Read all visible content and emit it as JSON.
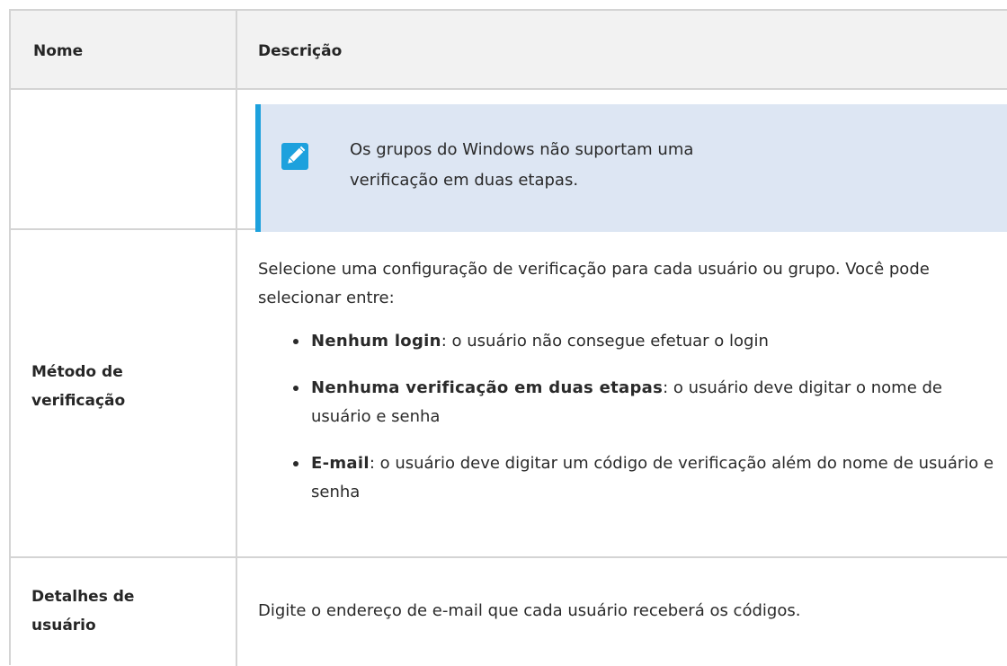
{
  "table": {
    "headers": {
      "name": "Nome",
      "description": "Descrição"
    },
    "note_row": {
      "icon": "pencil-note-icon",
      "note_text": "Os grupos do Windows não suportam uma verificação em duas etapas."
    },
    "method_row": {
      "name": "Método de verificação",
      "intro": "Selecione uma configuração de verificação para cada usuário ou grupo. Você pode selecionar entre:",
      "options": [
        {
          "term": "Nenhum login",
          "text": ": o usuário não consegue efetuar o login"
        },
        {
          "term": "Nenhuma verificação em duas etapas",
          "text": ": o usuário deve digitar o nome de usuário e senha"
        },
        {
          "term": "E-mail",
          "text": ": o usuário deve digitar um código de verificação além do nome de usuário e senha"
        }
      ]
    },
    "details_row": {
      "name": "Detalhes de usuário",
      "description": "Digite o endereço de e-mail que cada usuário receberá os códigos."
    }
  },
  "colors": {
    "note_background": "#dde6f3",
    "note_accent": "#1da1dd",
    "header_background": "#f2f2f2",
    "border": "#d4d4d4"
  }
}
